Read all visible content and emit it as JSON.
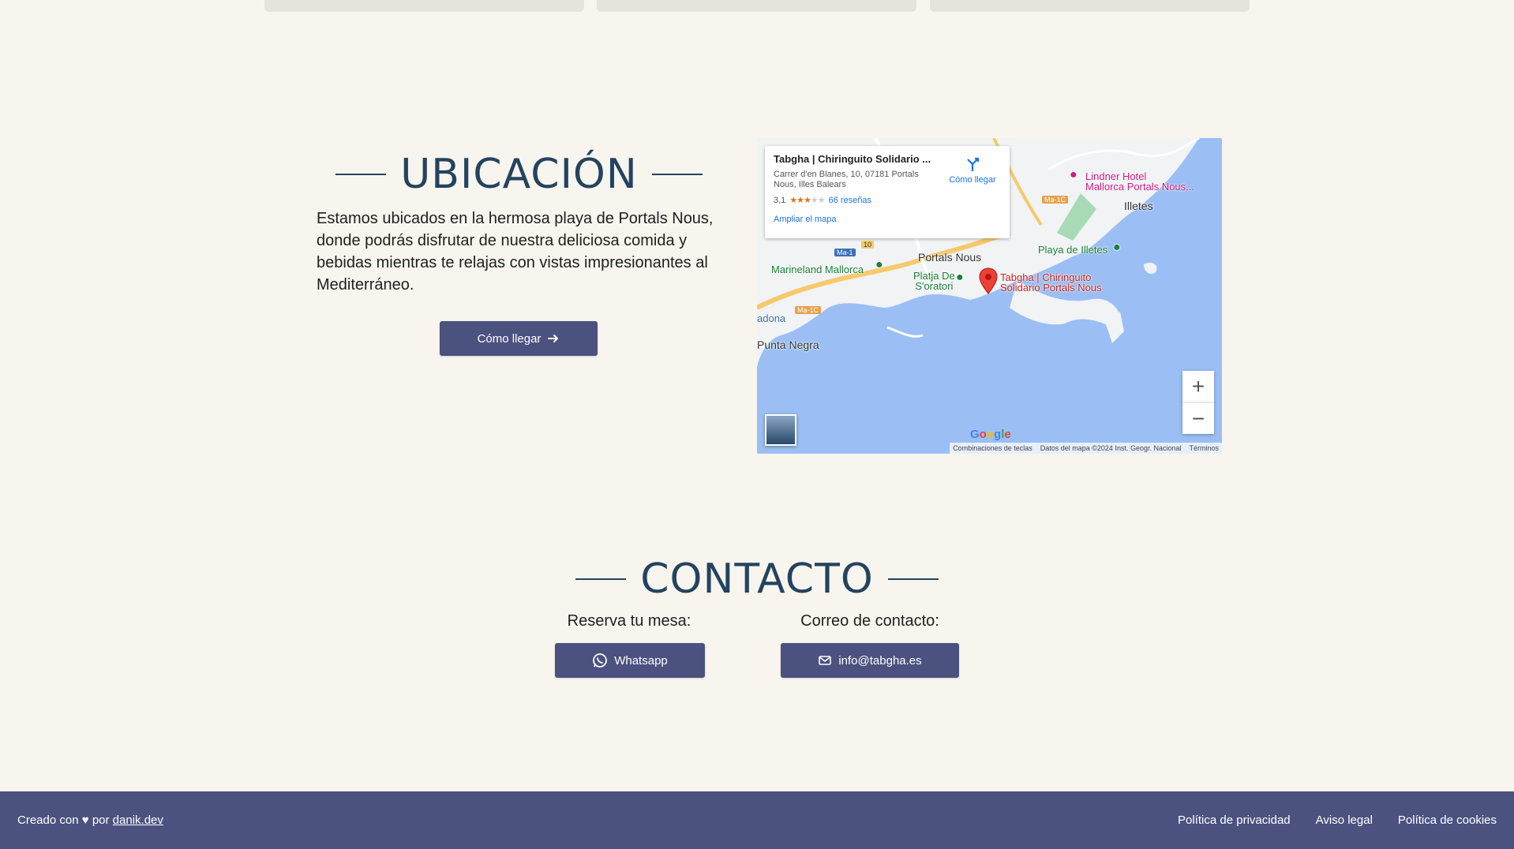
{
  "ubicacion": {
    "title": "UBICACIÓN",
    "description": "Estamos ubicados en la hermosa playa de Portals Nous, donde podrás disfrutar de nuestra deliciosa comida y bebidas mientras te relajas con vistas impresionantes al Mediterráneo.",
    "button_label": "Cómo llegar"
  },
  "map": {
    "place_name": "Tabgha | Chiringuito Solidario ...",
    "address": "Carrer d'en Blanes, 10, 07181 Portals Nous, Illes Balears",
    "rating": "3,1",
    "reviews": "66 reseñas",
    "enlarge": "Ampliar el mapa",
    "directions": "Cómo llegar",
    "labels": {
      "portals_nous": "Portals Nous",
      "illetes": "Illetes",
      "marineland": "Marineland Mallorca",
      "platja_oratori_1": "Platja De",
      "platja_oratori_2": "S'oratori",
      "playa_illetes": "Playa de Illetes",
      "tabgha_1": "Tabgha | Chiringuito",
      "tabgha_2": "Solidario Portals Nous",
      "lindner_1": "Lindner Hotel",
      "lindner_2": "Mallorca Portals Nous...",
      "punta_negra": "Punta Negra",
      "adona": "adona"
    },
    "roads": {
      "ma1": "Ma-1",
      "ma1c_a": "Ma-1C",
      "ma1c_b": "Ma-1C",
      "r10": "10"
    },
    "zoom_in": "+",
    "zoom_out": "−",
    "google": "Google",
    "attribution": {
      "shortcuts": "Combinaciones de teclas",
      "data": "Datos del mapa ©2024 Inst. Geogr. Nacional",
      "terms": "Términos"
    }
  },
  "contacto": {
    "title": "CONTACTO",
    "reserve_label": "Reserva tu mesa:",
    "email_label": "Correo de contacto:",
    "whatsapp_button": "Whatsapp",
    "email_button": "info@tabgha.es"
  },
  "footer": {
    "created_prefix": "Creado con",
    "heart": "♥",
    "by": "por",
    "author_link": "danik.dev",
    "links": [
      "Política de privacidad",
      "Aviso legal",
      "Política de cookies"
    ]
  }
}
